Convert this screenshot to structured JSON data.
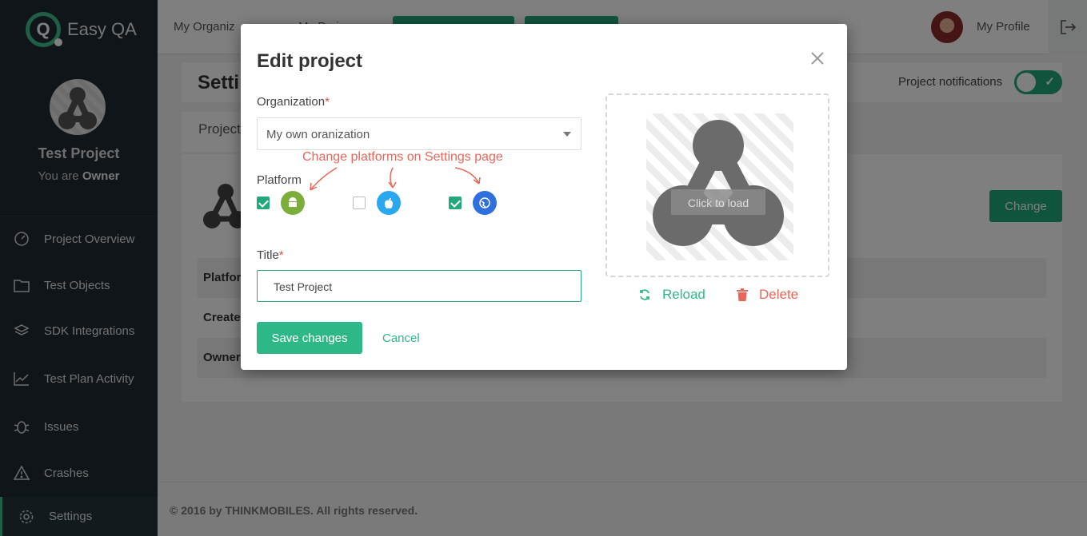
{
  "app": {
    "logo_text": "Easy QA"
  },
  "sidebar": {
    "project_name": "Test Project",
    "role_prefix": "You are",
    "role": "Owner",
    "items": [
      {
        "label": "Project Overview",
        "icon": "gauge-icon"
      },
      {
        "label": "Test Objects",
        "icon": "folder-icon"
      },
      {
        "label": "SDK Integrations",
        "icon": "layers-icon"
      },
      {
        "label": "Test Plan Activity",
        "icon": "chart-line-icon"
      },
      {
        "label": "Issues",
        "icon": "bug-icon"
      },
      {
        "label": "Crashes",
        "icon": "warning-icon"
      },
      {
        "label": "Settings",
        "icon": "gear-icon"
      }
    ]
  },
  "topbar": {
    "crumb_org": "My Organiz",
    "crumb_proj": "My Proj",
    "profile_label": "My Profile"
  },
  "settings": {
    "title": "Setti",
    "notifications_label": "Project notifications",
    "notifications_on": true,
    "tab_project": "Project",
    "change_button": "Change",
    "rows": [
      "Platfor",
      "Create",
      "Owner"
    ]
  },
  "footer": {
    "text": "© 2016 by THINKMOBILES. All rights reserved."
  },
  "modal": {
    "title": "Edit project",
    "organization_label": "Organization",
    "organization_value": "My own oranization",
    "hint": "Change platforms on Settings page",
    "platform_label": "Platform",
    "platforms": [
      {
        "name": "android-icon",
        "checked": true,
        "color": "#7cae3c"
      },
      {
        "name": "apple-icon",
        "checked": false,
        "color": "#29a8f0"
      },
      {
        "name": "web-icon",
        "checked": true,
        "color": "#2f6fe0"
      }
    ],
    "title_label": "Title",
    "title_value": "Test Project",
    "save_button": "Save changes",
    "cancel_link": "Cancel",
    "image_overlay_text": "Click to load",
    "reload_label": "Reload",
    "delete_label": "Delete"
  },
  "colors": {
    "accent": "#23a87a",
    "danger": "#e8665a",
    "sidebar_bg": "#1f2b33"
  }
}
